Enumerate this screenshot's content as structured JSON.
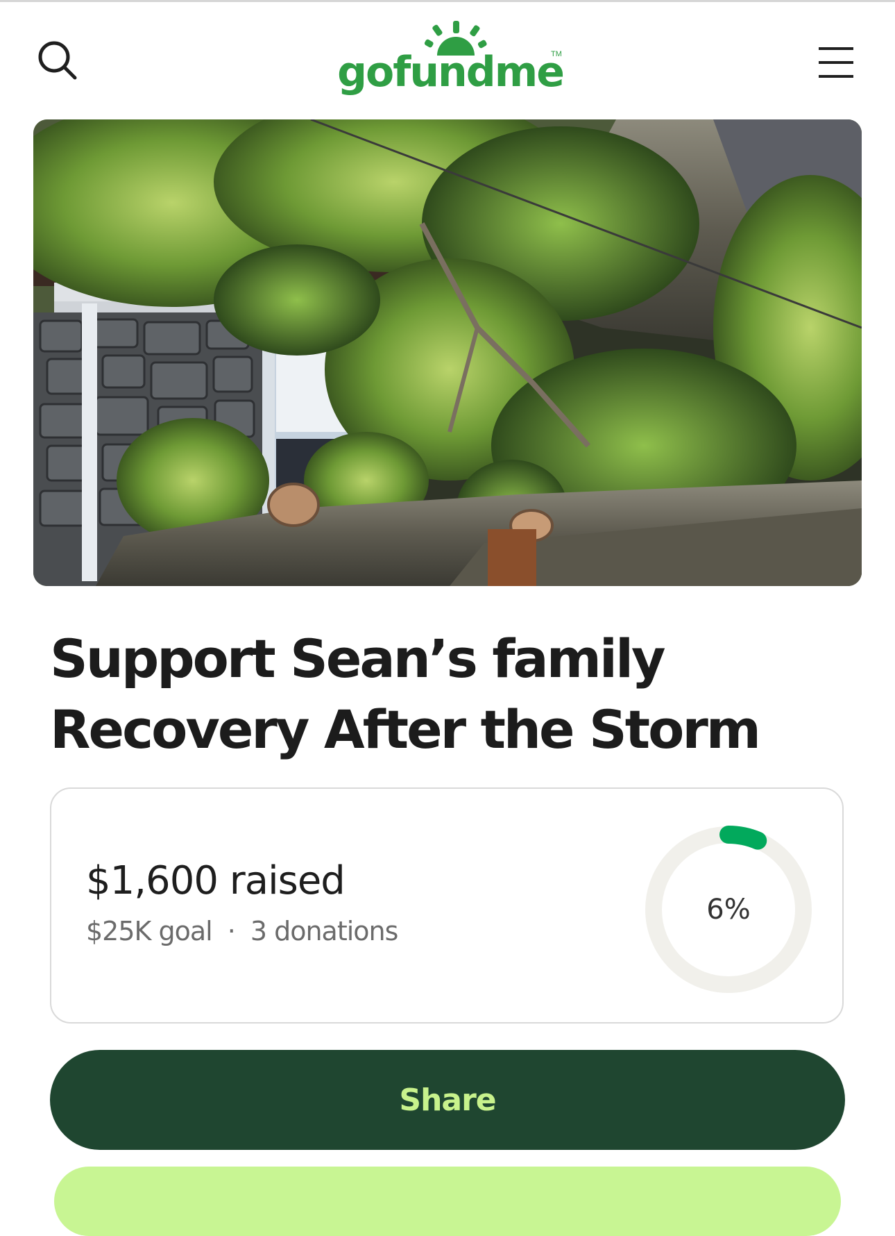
{
  "header": {
    "logo_text": "gofundme",
    "logo_tm": "TM",
    "search_icon": "search-icon",
    "menu_icon": "hamburger-menu-icon"
  },
  "campaign": {
    "image_alt": "Fallen tree on a stone house after a storm",
    "title_line1": "Support Sean’s family",
    "title_line2": "Recovery After the Storm"
  },
  "progress": {
    "raised_text": "$1,600 raised",
    "goal_text": "$25K goal",
    "separator": "·",
    "donations_text": "3 donations",
    "percent_text": "6%",
    "percent_value": 0.064
  },
  "actions": {
    "share_label": "Share"
  },
  "colors": {
    "brand_green": "#2f9e44",
    "progress_green": "#02a95c",
    "share_bg": "#1f4630",
    "share_text": "#c8f28c",
    "donate_bg": "#c8f593"
  }
}
